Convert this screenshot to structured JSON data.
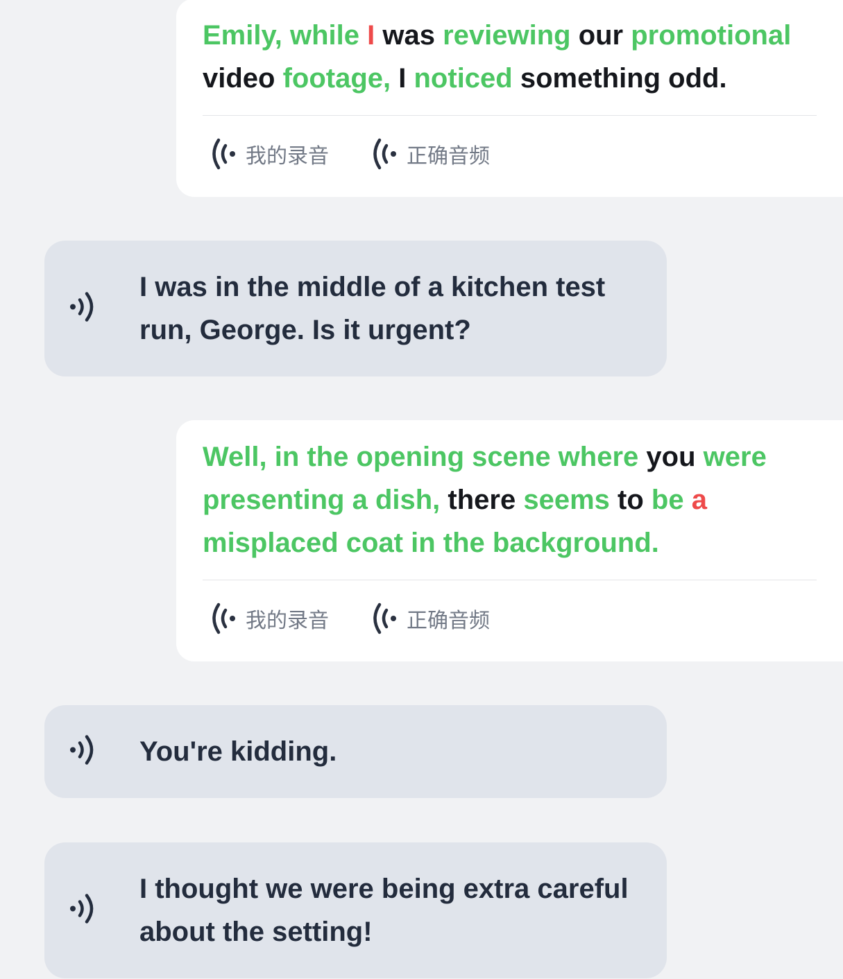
{
  "messages": [
    {
      "role": "user",
      "segments": [
        {
          "text": "Emily, while ",
          "status": "correct"
        },
        {
          "text": "I ",
          "status": "wrong"
        },
        {
          "text": "was ",
          "status": "neutral"
        },
        {
          "text": "reviewing ",
          "status": "correct"
        },
        {
          "text": "our ",
          "status": "neutral"
        },
        {
          "text": "promotional ",
          "status": "correct"
        },
        {
          "text": "video ",
          "status": "neutral"
        },
        {
          "text": "footage, ",
          "status": "correct"
        },
        {
          "text": "I ",
          "status": "neutral"
        },
        {
          "text": "noticed ",
          "status": "correct"
        },
        {
          "text": "something odd.",
          "status": "neutral"
        }
      ],
      "my_recording_label": "我的录音",
      "correct_audio_label": "正确音频"
    },
    {
      "role": "assistant",
      "text": "I was in the middle of a kitchen test run, George. Is it urgent?"
    },
    {
      "role": "user",
      "segments": [
        {
          "text": "Well, in the opening scene where ",
          "status": "correct"
        },
        {
          "text": "you ",
          "status": "neutral"
        },
        {
          "text": "were presenting a dish, ",
          "status": "correct"
        },
        {
          "text": "there ",
          "status": "neutral"
        },
        {
          "text": "seems ",
          "status": "correct"
        },
        {
          "text": "to ",
          "status": "neutral"
        },
        {
          "text": "be ",
          "status": "correct"
        },
        {
          "text": "a ",
          "status": "wrong"
        },
        {
          "text": "misplaced coat in the background.",
          "status": "correct"
        }
      ],
      "my_recording_label": "我的录音",
      "correct_audio_label": "正确音频"
    },
    {
      "role": "assistant",
      "text": "You're kidding."
    },
    {
      "role": "assistant",
      "text": "I thought we were being extra careful about the setting!"
    }
  ],
  "colors": {
    "correct": "#4cc663",
    "wrong": "#ee4a4a",
    "neutral": "#15171c",
    "assistant_bubble": "#e0e4eb",
    "background": "#f1f2f4"
  },
  "icons": {
    "replay": "broadcast-waves-icon",
    "speaker": "speaker-waves-icon"
  }
}
